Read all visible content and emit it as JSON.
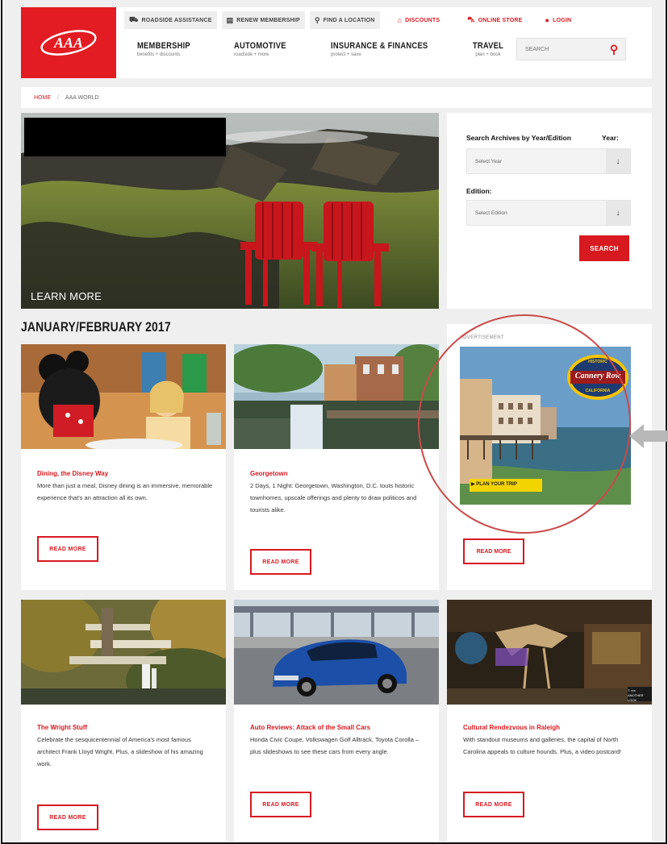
{
  "header": {
    "utility": [
      {
        "label": "ROADSIDE ASSISTANCE",
        "icon": "car-icon"
      },
      {
        "label": "RENEW MEMBERSHIP",
        "icon": "card-icon"
      },
      {
        "label": "FIND A LOCATION",
        "icon": "location-pin-icon"
      },
      {
        "label": "DISCOUNTS",
        "icon": "tag-icon"
      },
      {
        "label": "ONLINE STORE",
        "icon": "cart-icon"
      },
      {
        "label": "LOGIN",
        "icon": "user-icon"
      }
    ],
    "nav": [
      {
        "title": "MEMBERSHIP",
        "sub": "benefits + discounts"
      },
      {
        "title": "AUTOMOTIVE",
        "sub": "roadside + more"
      },
      {
        "title": "INSURANCE & FINANCES",
        "sub": "protect + save"
      },
      {
        "title": "TRAVEL",
        "sub": "plan + book"
      }
    ],
    "search_placeholder": "SEARCH",
    "brand_color": "#d71920"
  },
  "breadcrumb": {
    "home": "HOME",
    "current": "AAA WORLD"
  },
  "hero": {
    "cta": "LEARN MORE"
  },
  "archive": {
    "heading": "Search Archives by Year/Edition",
    "year_label": "Year:",
    "year_value": "Select Year",
    "edition_label": "Edition:",
    "edition_value": "Select Edition",
    "button": "SEARCH"
  },
  "issue_title": "JANUARY/FEBRUARY 2017",
  "articles": [
    {
      "title": "Dining, the Disney Way",
      "desc": "More than just a meal, Disney dining is an immersive, memorable experience that's an attraction all its own.",
      "cta": "READ MORE"
    },
    {
      "title": "Georgetown",
      "desc": "2 Days, 1 Night: Georgetown, Washington, D.C. touts historic townhomes, upscale offerings and plenty to draw politicos and tourists alike.",
      "cta": "READ MORE"
    },
    {
      "title": "The Wright Stuff",
      "desc": "Celebrate the sesquicentennial of America's most famous architect Frank Lloyd Wright. Plus, a slideshow of his amazing work.",
      "cta": "READ MORE"
    },
    {
      "title": "Auto Reviews: Attack of the Small Cars",
      "desc": "Honda Civic Coupe, Volkswagen Golf Alltrack, Toyota Corolla – plus slideshows to see these cars from every angle.",
      "cta": "READ MORE"
    },
    {
      "title": "Cultural Rendezvous in Raleigh",
      "desc": "With standout museums and galleries, the capital of North Carolina appeals to culture hounds. Plus, a video postcard!",
      "cta": "READ MORE"
    }
  ],
  "ad": {
    "label": "ADVERTISEMENT",
    "brand_top": "HISTORIC",
    "brand": "Cannery Row",
    "brand_bottom": "CALIFORNIA",
    "cta": "PLAN YOUR TRIP",
    "read_more": "READ MORE"
  },
  "exhibit_caption": "T. rex ANOTHER LOOK"
}
